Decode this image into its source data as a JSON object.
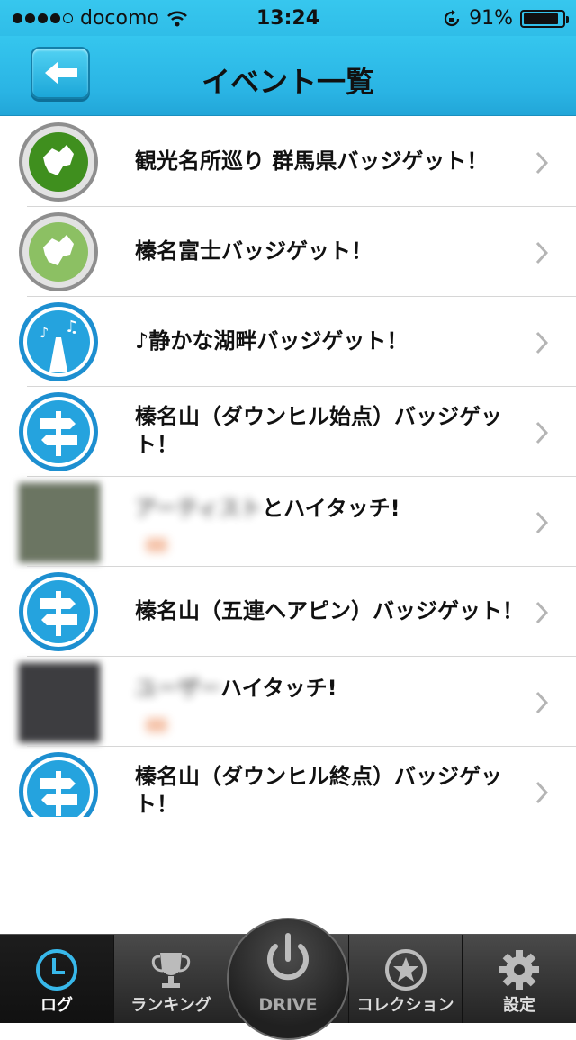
{
  "status_bar": {
    "carrier": "docomo",
    "time": "13:24",
    "battery": "91%",
    "battery_level": 0.91
  },
  "header": {
    "title": "イベント一覧",
    "back_icon": "back-arrow-icon"
  },
  "events": [
    {
      "title": "観光名所巡り 群馬県バッジゲット！",
      "icon": "gunma-badge-icon"
    },
    {
      "title": "榛名富士バッジゲット！",
      "icon": "gunma-badge-light-icon"
    },
    {
      "title": "♪静かな湖畔バッジゲット！",
      "icon": "music-road-badge-icon"
    },
    {
      "title": "榛名山（ダウンヒル始点）バッジゲット！",
      "icon": "signpost-badge-icon"
    },
    {
      "title": "とハイタッチ!",
      "subtitle": "",
      "icon": "blurred-photo"
    },
    {
      "title": "榛名山（五連ヘアピン）バッジゲット！",
      "icon": "signpost-badge-icon"
    },
    {
      "title": "ハイタッチ!",
      "subtitle": "",
      "icon": "blurred-photo"
    },
    {
      "title": "榛名山（ダウンヒル終点）バッジゲット！",
      "icon": "signpost-badge-icon"
    }
  ],
  "tabbar": {
    "tabs": [
      {
        "label": "ログ",
        "icon": "clock-icon",
        "active": true
      },
      {
        "label": "ランキング",
        "icon": "trophy-icon",
        "active": false
      },
      {
        "label": "DRIVE",
        "icon": "power-icon",
        "active": false
      },
      {
        "label": "コレクション",
        "icon": "star-circle-icon",
        "active": false
      },
      {
        "label": "設定",
        "icon": "gear-icon",
        "active": false
      }
    ]
  }
}
